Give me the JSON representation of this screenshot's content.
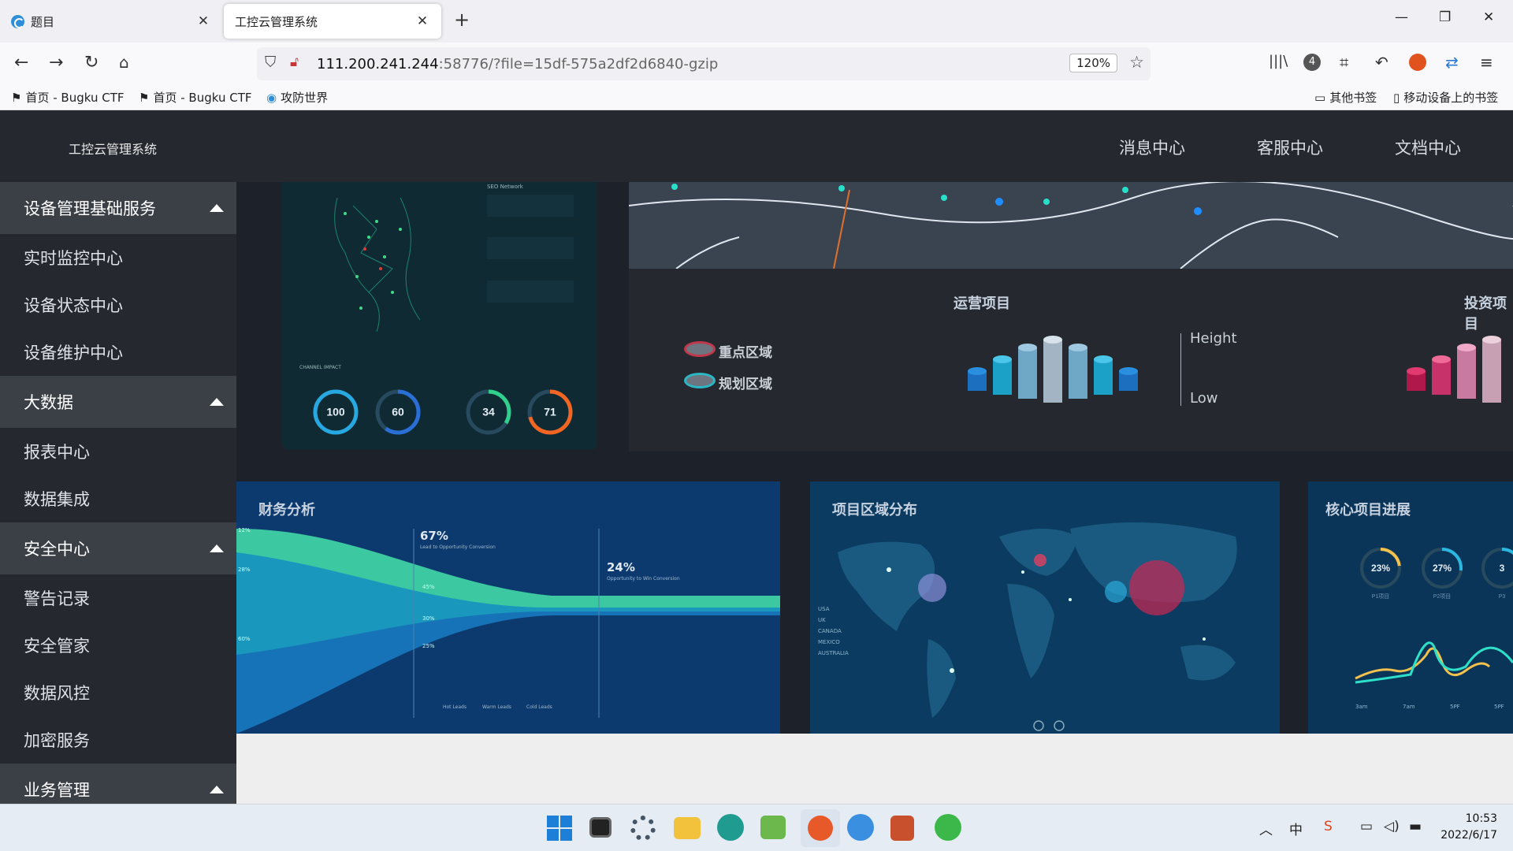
{
  "browser": {
    "tabs": [
      {
        "title": "题目",
        "active": false
      },
      {
        "title": "工控云管理系统",
        "active": true
      }
    ],
    "new_tab_label": "+",
    "window_controls": {
      "minimize": "—",
      "restore": "❐",
      "close": "✕"
    },
    "url": {
      "host": "111.200.241.244",
      "rest": ":58776/?file=15df-575a2df2d6840-gzip"
    },
    "zoom": "120%",
    "toolbar_badge": "4",
    "bookmarks": [
      {
        "label": "首页 - Bugku CTF",
        "icon": "flag-icon"
      },
      {
        "label": "首页 - Bugku CTF",
        "icon": "flag-icon"
      },
      {
        "label": "攻防世界",
        "icon": "globe-icon"
      }
    ],
    "other_bookmarks": "其他书签",
    "mobile_bookmarks": "移动设备上的书签"
  },
  "app": {
    "title": "工控云管理系统",
    "topnav": [
      "消息中心",
      "客服中心",
      "文档中心"
    ]
  },
  "sidebar": {
    "groups": [
      {
        "label": "设备管理基础服务",
        "items": [
          "实时监控中心",
          "设备状态中心",
          "设备维护中心"
        ]
      },
      {
        "label": "大数据",
        "items": [
          "报表中心",
          "数据集成"
        ]
      },
      {
        "label": "安全中心",
        "items": [
          "警告记录",
          "安全管家",
          "数据风控",
          "加密服务"
        ]
      },
      {
        "label": "业务管理",
        "items": []
      }
    ]
  },
  "dashboard": {
    "face_panel": {
      "channel_label": "CHANNEL IMPACT",
      "feed_label": "SEO Network",
      "gauges": [
        {
          "label": "100",
          "value": 1.0,
          "color": "#28a8e0"
        },
        {
          "label": "60",
          "value": 0.6,
          "color": "#2a6fd6"
        },
        {
          "label": "34",
          "value": 0.34,
          "color": "#2fd08c"
        },
        {
          "label": "71",
          "value": 0.71,
          "color": "#f26522"
        }
      ]
    },
    "ops_panel": {
      "title": "运营项目",
      "title2": "投资项目",
      "legend": [
        {
          "label": "重点区域",
          "color": "#c0394b"
        },
        {
          "label": "规划区域",
          "color": "#2bb7c4"
        }
      ],
      "scale_high": "Height",
      "scale_low": "Low"
    },
    "finance": {
      "title": "财务分析",
      "big_pct_1": "67%",
      "big_pct_2": "24%",
      "note_1": "Lead to Opportunity Conversion",
      "note_2": "Opportunity to Win Conversion",
      "left_labels": [
        "12%",
        "28%",
        "60%"
      ],
      "mid_labels": [
        "45%",
        "30%",
        "25%"
      ],
      "legend": [
        "Hot Leads",
        "Warm Leads",
        "Cold Leads"
      ]
    },
    "region": {
      "title": "项目区域分布",
      "legend": [
        "USA",
        "UK",
        "CANADA",
        "MEXICO",
        "AUSTRALIA"
      ]
    },
    "progress": {
      "title": "核心项目进展",
      "gauges": [
        {
          "label": "23%",
          "value": 0.23,
          "color": "#f2c14e",
          "caption": "P1项目"
        },
        {
          "label": "27%",
          "value": 0.27,
          "color": "#2bb7e0",
          "caption": "P2项目"
        },
        {
          "label": "3",
          "value": 0.35,
          "color": "#2bb7e0",
          "caption": "P3"
        }
      ],
      "x_labels": [
        "3am",
        "7am",
        "5PF",
        "5PF"
      ]
    }
  },
  "taskbar": {
    "time": "10:53",
    "date": "2022/6/17",
    "lang": "中"
  }
}
